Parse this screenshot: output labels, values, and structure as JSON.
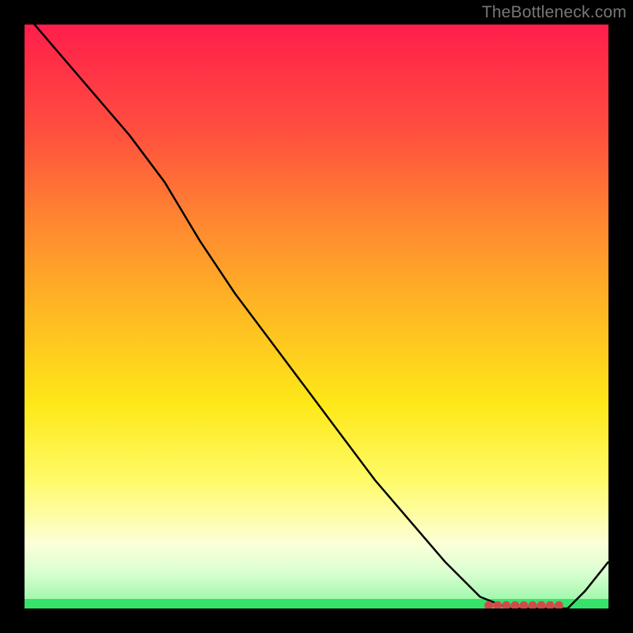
{
  "watermark": "TheBottleneck.com",
  "colors": {
    "page_bg": "#000000",
    "watermark_text": "#777777",
    "curve": "#000000",
    "dots": "#cf4b4b",
    "gradient_top": "#ff1e4b",
    "gradient_bottom_band": "#37e26a"
  },
  "chart_data": {
    "type": "line",
    "title": "",
    "xlabel": "",
    "ylabel": "",
    "xlim": [
      0,
      100
    ],
    "ylim": [
      0,
      100
    ],
    "grid": false,
    "legend": false,
    "series": [
      {
        "name": "bottleneck-curve",
        "x": [
          0,
          6,
          12,
          18,
          24,
          30,
          36,
          42,
          48,
          54,
          60,
          66,
          72,
          78,
          83,
          87,
          90,
          93,
          96,
          100
        ],
        "y": [
          102,
          95,
          88,
          81,
          73,
          63,
          54,
          46,
          38,
          30,
          22,
          15,
          8,
          2,
          0,
          0,
          0,
          0,
          3,
          8
        ]
      }
    ],
    "flat_zone_dots": {
      "y": 0.5,
      "x": [
        79.5,
        81,
        82.5,
        84,
        85.5,
        87,
        88.5,
        90,
        91.5
      ]
    }
  }
}
